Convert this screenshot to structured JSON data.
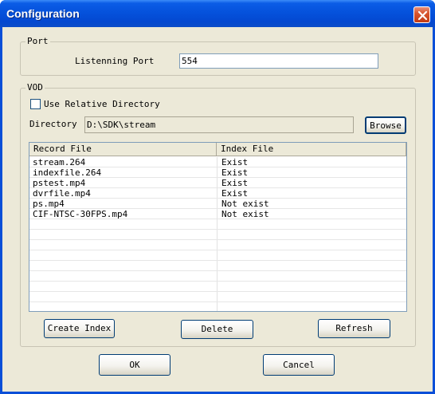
{
  "window": {
    "title": "Configuration"
  },
  "port": {
    "group_label": "Port",
    "listening_port_label": "Listenning Port",
    "listening_port_value": "554"
  },
  "vod": {
    "group_label": "VOD",
    "use_relative_directory_label": "Use Relative Directory",
    "use_relative_directory_checked": false,
    "directory_label": "Directory",
    "directory_value": "D:\\SDK\\stream",
    "browse_label": "Browse",
    "columns": [
      "Record File",
      "Index File"
    ],
    "rows": [
      [
        "stream.264",
        "Exist"
      ],
      [
        "indexfile.264",
        "Exist"
      ],
      [
        "pstest.mp4",
        "Exist"
      ],
      [
        "dvrfile.mp4",
        "Exist"
      ],
      [
        "ps.mp4",
        "Not exist"
      ],
      [
        "CIF-NTSC-30FPS.mp4",
        "Not exist"
      ]
    ],
    "create_index_label": "Create Index",
    "delete_label": "Delete",
    "refresh_label": "Refresh"
  },
  "footer": {
    "ok_label": "OK",
    "cancel_label": "Cancel"
  },
  "icons": {
    "close": "close-icon"
  },
  "colors": {
    "titlebar": "#0552dc",
    "client": "#ece9d8",
    "close": "#d8552e"
  }
}
